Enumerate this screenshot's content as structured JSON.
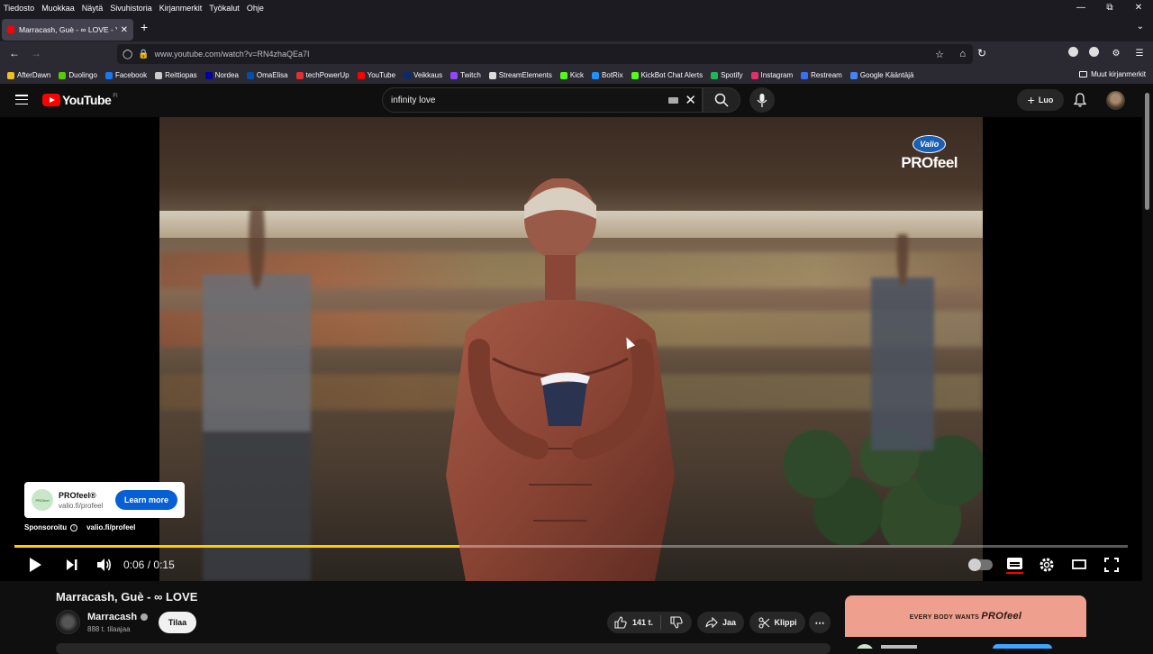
{
  "browser": {
    "menu": [
      "Tiedosto",
      "Muokkaa",
      "Näytä",
      "Sivuhistoria",
      "Kirjanmerkit",
      "Työkalut",
      "Ohje"
    ],
    "tab_title": "Marracash, Guè - ∞ LOVE - You",
    "url": "www.youtube.com/watch?v=RN4zhaQEa7I",
    "bookmarks": [
      {
        "label": "AfterDawn",
        "color": "#f0c020"
      },
      {
        "label": "Duolingo",
        "color": "#58cc02"
      },
      {
        "label": "Facebook",
        "color": "#1877f2"
      },
      {
        "label": "Reittiopas",
        "color": "#cccccc"
      },
      {
        "label": "Nordea",
        "color": "#0000a0"
      },
      {
        "label": "OmaElisa",
        "color": "#0050aa"
      },
      {
        "label": "techPowerUp",
        "color": "#e03030"
      },
      {
        "label": "YouTube",
        "color": "#ff0000"
      },
      {
        "label": "Veikkaus",
        "color": "#0a2a6a"
      },
      {
        "label": "Twitch",
        "color": "#9146ff"
      },
      {
        "label": "StreamElements",
        "color": "#dddddd"
      },
      {
        "label": "Kick",
        "color": "#53fc18"
      },
      {
        "label": "BotRix",
        "color": "#1e90ff"
      },
      {
        "label": "KickBot Chat Alerts",
        "color": "#53fc18"
      },
      {
        "label": "Spotify",
        "color": "#1db954"
      },
      {
        "label": "Instagram",
        "color": "#e1306c"
      },
      {
        "label": "Restream",
        "color": "#3a6ff7"
      },
      {
        "label": "Google Kääntäjä",
        "color": "#4285f4"
      }
    ],
    "other_bookmarks": "Muut kirjanmerkit"
  },
  "youtube": {
    "logo_text": "YouTube",
    "country": "FI",
    "search_query": "infinity love",
    "create_label": "Luo"
  },
  "player": {
    "brand_badge": "Valio",
    "brand_name": "PROfeel",
    "ad": {
      "title": "PROfeel®",
      "url": "valio.fi/profeel",
      "cta": "Learn more",
      "thumb_text": "PROfeel",
      "sponsored": "Sponsoroitu",
      "link": "valio.fi/profeel"
    },
    "progress": 0.4,
    "time_current": "0:06",
    "time_separator": "/",
    "time_total": "0:15",
    "colors": {
      "progress": "#ffcc00",
      "cta": "#065fd4"
    }
  },
  "video": {
    "title": "Marracash, Guè - ∞ LOVE",
    "channel": "Marracash",
    "subscribers": "888 t. tilaajaa",
    "subscribe": "Tilaa",
    "likes": "141 t.",
    "share": "Jaa",
    "clip": "Klippi"
  },
  "side_ad": {
    "text_prefix": "EVERY BODY WANTS",
    "text_brand": "PROfeel"
  }
}
